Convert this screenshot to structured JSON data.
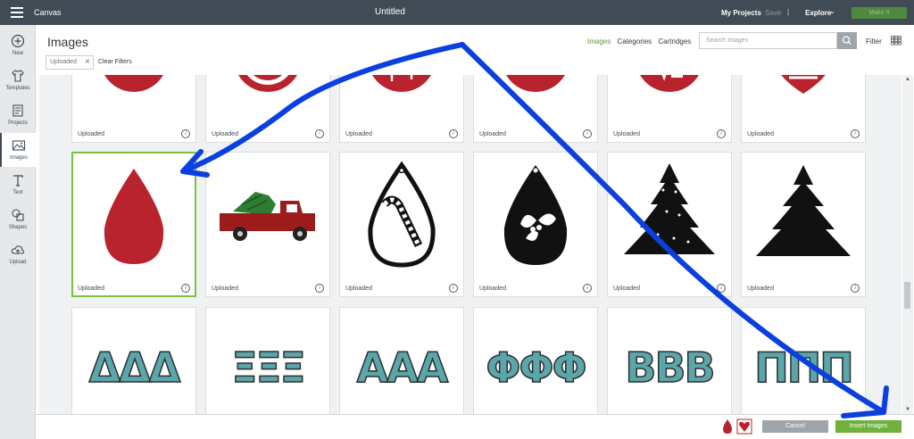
{
  "topbar": {
    "app_name": "Canvas",
    "document_title": "Untitled",
    "my_projects": "My Projects",
    "save": "Save",
    "separator": "|",
    "explore": "Explore",
    "make_it": "Make It"
  },
  "sidebar": {
    "items": [
      {
        "label": "New",
        "icon": "plus-circle-icon"
      },
      {
        "label": "Templates",
        "icon": "shirt-icon"
      },
      {
        "label": "Projects",
        "icon": "projects-icon"
      },
      {
        "label": "Images",
        "icon": "image-icon"
      },
      {
        "label": "Text",
        "icon": "text-icon"
      },
      {
        "label": "Shapes",
        "icon": "shapes-icon"
      },
      {
        "label": "Upload",
        "icon": "upload-cloud-icon"
      }
    ],
    "active": "Images"
  },
  "header": {
    "title": "Images",
    "tabs": [
      "Images",
      "Categories",
      "Cartridges"
    ],
    "active_tab": "Images",
    "search_placeholder": "Search Images",
    "filter_label": "Filter"
  },
  "filters": {
    "chip_label": "Uploaded",
    "clear_label": "Clear Filters"
  },
  "cards": {
    "label": "Uploaded",
    "info_glyph": "i",
    "row1": [
      "red-heart-circle",
      "red-heart-ring",
      "red-table-circle",
      "red-grid-circle",
      "red-ve-circle",
      "red-stripe-heart"
    ],
    "row2": [
      "red-teardrop",
      "red-truck-tree",
      "candy-cane-teardrop",
      "holly-teardrop",
      "christmas-tree-dots",
      "christmas-tree"
    ],
    "row3": [
      {
        "letters": "ΔΔΔ"
      },
      {
        "letters": "ΞΞΞ"
      },
      {
        "letters": "ΑΑΑ"
      },
      {
        "letters": "ΦΦΦ"
      },
      {
        "letters": "ΒΒΒ"
      },
      {
        "letters": "ΠΠΠ"
      }
    ]
  },
  "footer": {
    "cancel": "Cancel",
    "insert": "Insert Images"
  },
  "colors": {
    "topbar": "#414b55",
    "accent_green": "#6fb23b",
    "selection_green": "#7ac142",
    "art_red": "#b9232e",
    "annotation_blue": "#0a3fe0"
  }
}
